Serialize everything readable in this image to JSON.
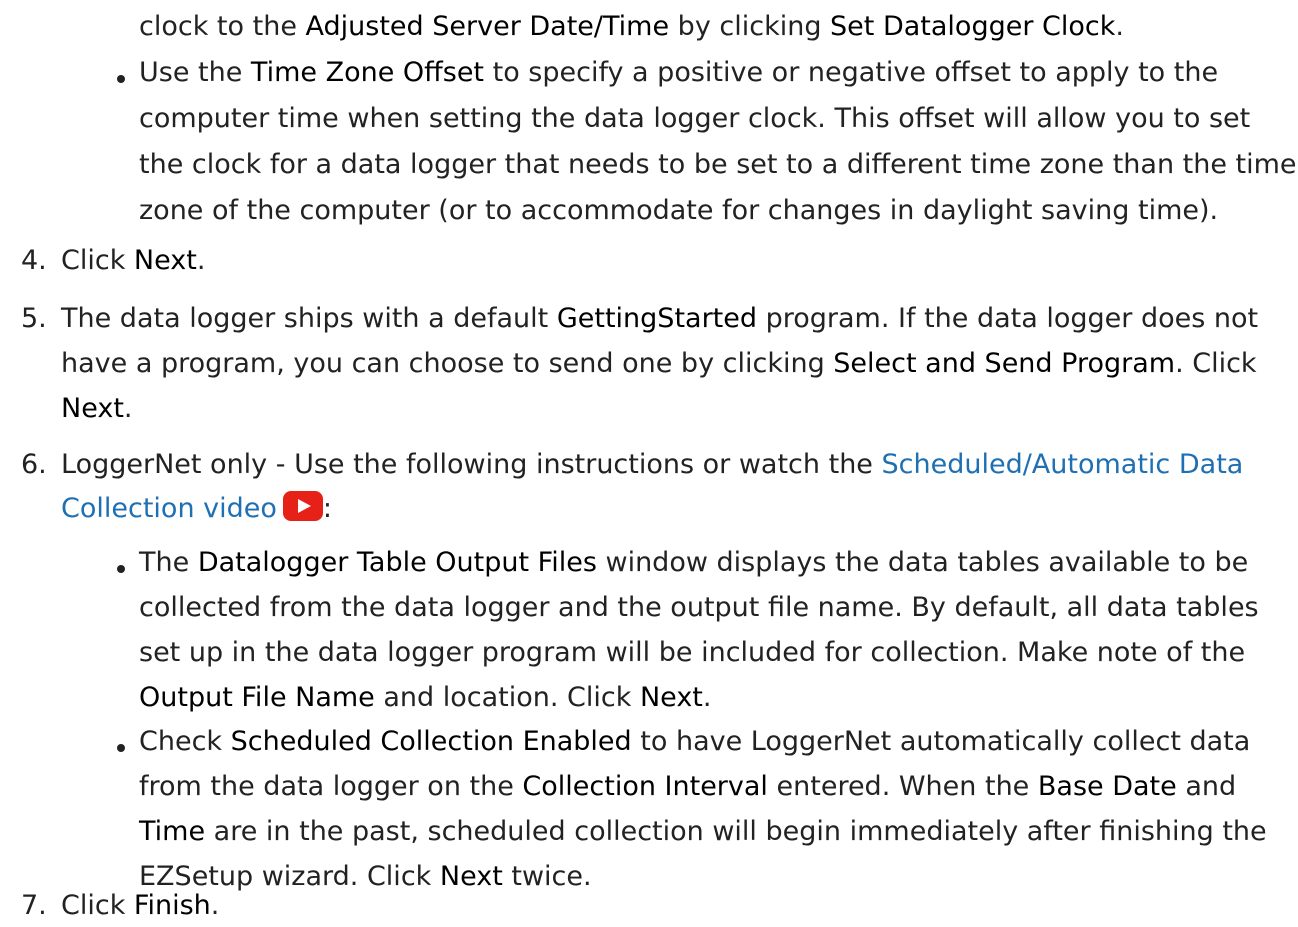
{
  "intro_line": {
    "t1": "clock to the ",
    "b1": "Adjusted Server Date/Time",
    "t2": " by clicking ",
    "b2": "Set Datalogger Clock",
    "t3": "."
  },
  "tz_bullet": {
    "l1_t1": "Use the ",
    "l1_b1": "Time Zone Offset",
    "l1_t2": " to specify a positive or negative offset to apply to the",
    "l2": "computer time when setting the data logger clock. This offset will allow you to set",
    "l3": "the clock for a data logger that needs to be set to a different time zone than the time",
    "l4": "zone of the computer (or to accommodate for changes in daylight saving time)."
  },
  "step4": {
    "num": "4.",
    "t1": "Click ",
    "b1": "Next",
    "t2": "."
  },
  "step5": {
    "num": "5.",
    "l1_t1": "The data logger ships with a default ",
    "l1_b1": "GettingStarted",
    "l1_t2": " program. If the data logger does not",
    "l2_t1": "have a program, you can choose to send one by clicking ",
    "l2_b1": "Select and Send Program",
    "l2_t2": ". Click",
    "l3_b1": "Next",
    "l3_t1": "."
  },
  "step6": {
    "num": "6.",
    "l1_t1": "LoggerNet only - Use the following instructions or watch the ",
    "l1_link": "Scheduled/Automatic Data",
    "l2_link": "Collection video",
    "l2_t1": ":",
    "video_icon": "youtube-play-icon",
    "bullet1": {
      "l1_t1": "The ",
      "l1_b1": "Datalogger Table Output Files",
      "l1_t2": " window displays the data tables available to be",
      "l2": "collected from the data logger and the output file name. By default, all data tables",
      "l3": "set up in the data logger program will be included for collection. Make note of the",
      "l4_b1": "Output File Name",
      "l4_t1": " and location. Click ",
      "l4_b2": "Next",
      "l4_t2": "."
    },
    "bullet2": {
      "l1_t1": "Check ",
      "l1_b1": "Scheduled Collection Enabled",
      "l1_t2": " to have LoggerNet automatically collect data",
      "l2_t1": "from the data logger on the ",
      "l2_b1": "Collection Interval",
      "l2_t2": " entered. When the ",
      "l2_b2": "Base Date",
      "l2_t3": " and",
      "l3_b1": "Time",
      "l3_t1": " are in the past, scheduled collection will begin immediately after finishing the",
      "l4_t1": "EZSetup wizard. Click ",
      "l4_b1": "Next",
      "l4_t2": " twice."
    }
  },
  "step7": {
    "num": "7.",
    "t1": "Click ",
    "b1": "Finish",
    "t2": "."
  },
  "colors": {
    "text": "#222222",
    "bold_text": "#000000",
    "link": "#1f6fb3",
    "video_icon": "#e62117"
  }
}
